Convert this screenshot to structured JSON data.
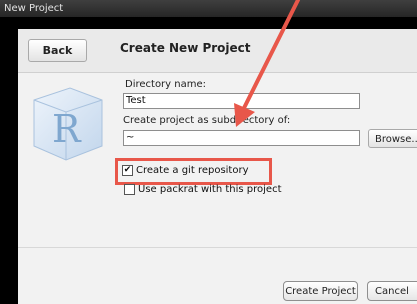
{
  "window": {
    "title": "New Project"
  },
  "header": {
    "back_label": "Back",
    "title": "Create New Project"
  },
  "form": {
    "directory_label": "Directory name:",
    "directory_value": "Test",
    "subdir_label": "Create project as subdirectory of:",
    "subdir_value": "~",
    "browse_label": "Browse..."
  },
  "options": {
    "git_label": "Create a git repository",
    "git_checked": true,
    "git_check_glyph": "✔",
    "packrat_label": "Use packrat with this project",
    "packrat_checked": false
  },
  "footer": {
    "create_label": "Create Project",
    "cancel_label": "Cancel"
  },
  "logo": {
    "letter": "R"
  },
  "colors": {
    "highlight": "#e8574a",
    "logo_blue": "#7fa7cf"
  }
}
